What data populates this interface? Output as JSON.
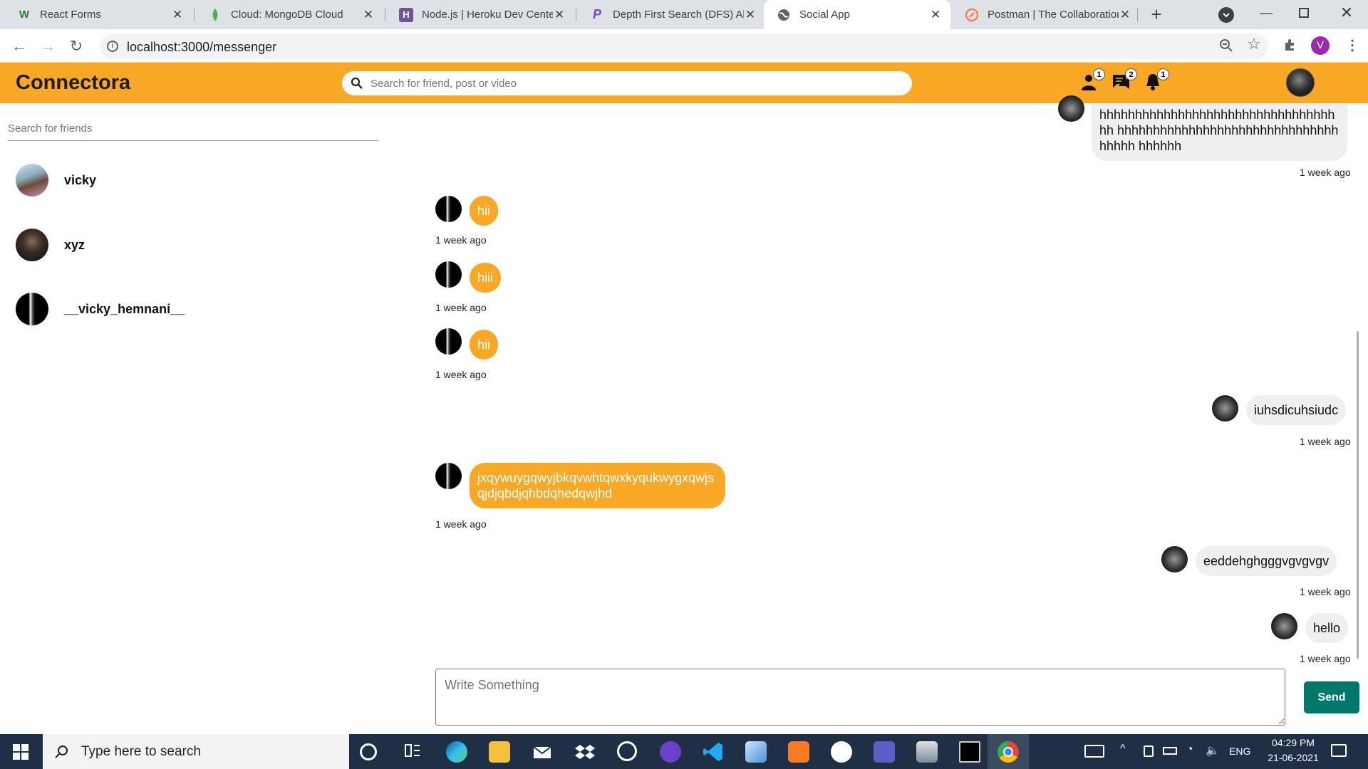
{
  "browser": {
    "tabs": [
      {
        "title": "React Forms",
        "favicon": "W",
        "color": "#2e7d32"
      },
      {
        "title": "Cloud: MongoDB Cloud",
        "favicon": "leaf",
        "color": "#4caf50"
      },
      {
        "title": "Node.js | Heroku Dev Cente",
        "favicon": "H",
        "color": "#6f5499"
      },
      {
        "title": "Depth First Search (DFS) Alg",
        "favicon": "P",
        "color": "#7b3fe4"
      },
      {
        "title": "Social App",
        "favicon": "globe",
        "color": "#5f6368"
      },
      {
        "title": "Postman | The Collaboration",
        "favicon": "postman",
        "color": "#ff6c37"
      }
    ],
    "url": "localhost:3000/messenger",
    "profile_initial": "V"
  },
  "app": {
    "brand": "Connectora",
    "search_placeholder": "Search for friend, post or video",
    "badges": {
      "friends": "1",
      "messages": "2",
      "notifications": "1"
    },
    "colors": {
      "header": "#f9a825",
      "send": "#00796b"
    }
  },
  "sidebar": {
    "search_placeholder": "Search for friends",
    "friends": [
      {
        "name": "vicky"
      },
      {
        "name": "xyz"
      },
      {
        "name": "__vicky_hemnani__"
      }
    ]
  },
  "chat": {
    "messages": [
      {
        "own": true,
        "text": "hhhhhhhhhhhhhhhhhhhhhhhhhhhhhhhhhhh hhhhhhhhhhhhhhhhhhhhhhhhhhhhhhhhhhhh hhhhhh",
        "time": "1 week ago"
      },
      {
        "own": false,
        "text": "hii",
        "time": "1 week ago"
      },
      {
        "own": false,
        "text": "hiii",
        "time": "1 week ago"
      },
      {
        "own": false,
        "text": "hii",
        "time": "1 week ago"
      },
      {
        "own": true,
        "text": "iuhsdicuhsiudc",
        "time": "1 week ago"
      },
      {
        "own": false,
        "text": "jxqywuygqwyjbkqvwhtqwxkyqukwygxqwjs qjdjqbdjqhbdqhedqwjhd",
        "time": "1 week ago"
      },
      {
        "own": true,
        "text": "eeddehghgggvgvgvgv",
        "time": "1 week ago"
      },
      {
        "own": true,
        "text": "hello",
        "time": "1 week ago"
      }
    ],
    "composer_placeholder": "Write Something",
    "send_label": "Send"
  },
  "taskbar": {
    "search_placeholder": "Type here to search",
    "language": "ENG",
    "time": "04:29 PM",
    "date": "21-06-2021"
  }
}
